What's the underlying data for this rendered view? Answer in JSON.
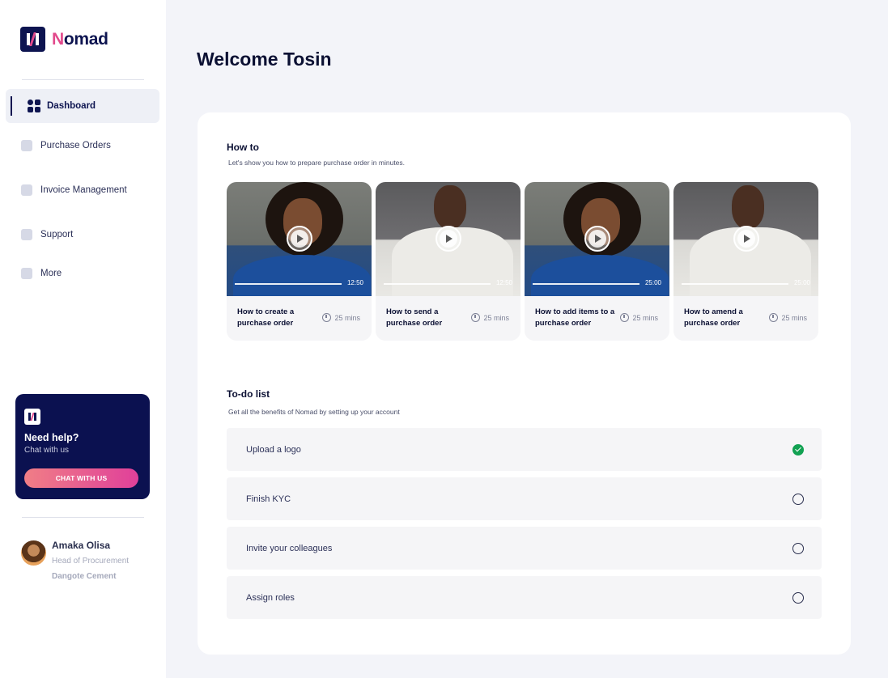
{
  "brand": {
    "name_first": "N",
    "name_rest": "omad"
  },
  "sidebar": {
    "items": [
      {
        "label": "Dashboard",
        "icon": "dashboard-grid-icon",
        "active": true
      },
      {
        "label": "Purchase Orders",
        "icon": "document-icon",
        "active": false
      },
      {
        "label": "Invoice Management",
        "icon": "chart-icon",
        "active": false
      },
      {
        "label": "Support",
        "icon": "chart-icon",
        "active": false
      },
      {
        "label": "More",
        "icon": "wallet-icon",
        "active": false
      }
    ],
    "help": {
      "title": "Need help?",
      "subtitle": "Chat with us",
      "button_label": "CHAT WITH US"
    },
    "user": {
      "name": "Amaka Olisa",
      "role": "Head of Procurement",
      "company": "Dangote Cement"
    }
  },
  "main": {
    "welcome": "Welcome Tosin",
    "howto": {
      "title": "How to",
      "subtitle": "Let's show you how to prepare purchase order in minutes.",
      "videos": [
        {
          "title": "How to create a purchase order",
          "duration": "12:50",
          "length": "25 mins",
          "thumbnail": "woman"
        },
        {
          "title": "How to send a purchase order",
          "duration": "12:50",
          "length": "25 mins",
          "thumbnail": "man"
        },
        {
          "title": "How to add items to a purchase order",
          "duration": "25:00",
          "length": "25 mins",
          "thumbnail": "woman"
        },
        {
          "title": "How to amend a purchase order",
          "duration": "25:00",
          "length": "25 mins",
          "thumbnail": "man"
        }
      ]
    },
    "todo": {
      "title": "To-do list",
      "subtitle": "Get all the benefits of Nomad by setting up your account",
      "items": [
        {
          "label": "Upload a logo",
          "done": true
        },
        {
          "label": "Finish KYC",
          "done": false
        },
        {
          "label": "Invite your colleagues",
          "done": false
        },
        {
          "label": "Assign roles",
          "done": false
        }
      ]
    }
  },
  "colors": {
    "brand_navy": "#0d1450",
    "brand_pink": "#e24a8c",
    "success_green": "#12a152",
    "background": "#f3f4f9"
  }
}
